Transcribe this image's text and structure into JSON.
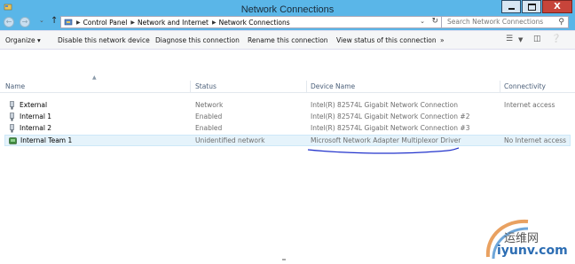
{
  "window": {
    "title": "Network Connections",
    "close_glyph": "X"
  },
  "address_bar": {
    "breadcrumbs": [
      "Control Panel",
      "Network and Internet",
      "Network Connections"
    ],
    "search_placeholder": "Search Network Connections"
  },
  "command_bar": {
    "organize": "Organize ▾",
    "disable": "Disable this network device",
    "diagnose": "Diagnose this connection",
    "rename": "Rename this connection",
    "view_status": "View status of this connection",
    "more": "»"
  },
  "columns": [
    "Name",
    "Status",
    "Device Name",
    "Connectivity"
  ],
  "rows": [
    {
      "name": "External",
      "status": "Network",
      "device": "Intel(R) 82574L Gigabit Network Connection",
      "connectivity": "Internet access",
      "icon": "network-adapter-icon"
    },
    {
      "name": "Internal 1",
      "status": "Enabled",
      "device": "Intel(R) 82574L Gigabit Network Connection #2",
      "connectivity": "",
      "icon": "network-adapter-icon"
    },
    {
      "name": "Internal 2",
      "status": "Enabled",
      "device": "Intel(R) 82574L Gigabit Network Connection #3",
      "connectivity": "",
      "icon": "network-adapter-icon"
    },
    {
      "name": "Internal Team 1",
      "status": "Unidentified network",
      "device": "Microsoft Network Adapter Multiplexor Driver",
      "connectivity": "No Internet access",
      "icon": "team-adapter-icon",
      "selected": true
    }
  ],
  "watermark": {
    "line1": "运维网",
    "line2": "iyunv.com"
  },
  "colors": {
    "titlebar": "#5ab6e8",
    "selection": "#e5f3fb",
    "annotation": "#2233cc"
  }
}
